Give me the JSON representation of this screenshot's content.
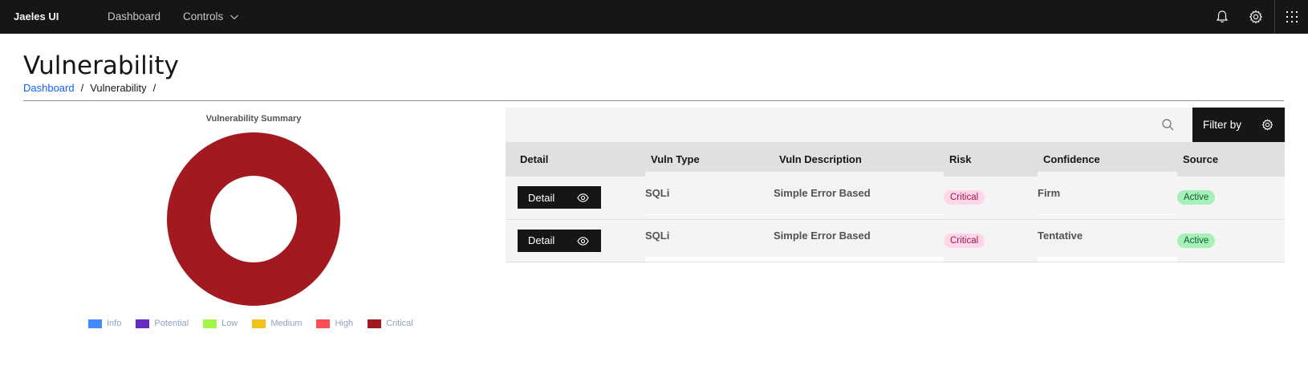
{
  "header": {
    "brand": "Jaeles UI",
    "nav": {
      "dashboard": "Dashboard",
      "controls": "Controls"
    },
    "icons": [
      "bell-icon",
      "gear-icon",
      "app-grid-icon"
    ]
  },
  "page": {
    "title": "Vulnerability",
    "breadcrumb": {
      "link": "Dashboard",
      "current": "Vulnerability",
      "separator": "/"
    }
  },
  "chart_data": {
    "type": "pie",
    "title": "Vulnerability Summary",
    "donut": true,
    "categories": [
      "Info",
      "Potential",
      "Low",
      "Medium",
      "High",
      "Critical"
    ],
    "values": [
      0,
      0,
      0,
      0,
      0,
      2
    ],
    "colors": [
      "#4589ff",
      "#6929c4",
      "#a2f64a",
      "#f1c21b",
      "#fa4d56",
      "#a2191f"
    ],
    "legend_position": "bottom"
  },
  "table": {
    "filter_label": "Filter by",
    "headers": [
      "Detail",
      "Vuln Type",
      "Vuln Description",
      "Risk",
      "Confidence",
      "Source"
    ],
    "rows": [
      {
        "detail": "Detail",
        "vuln_type": "SQLi",
        "description": "Simple Error Based",
        "risk": "Critical",
        "confidence": "Firm",
        "source": "Active"
      },
      {
        "detail": "Detail",
        "vuln_type": "SQLi",
        "description": "Simple Error Based",
        "risk": "Critical",
        "confidence": "Tentative",
        "source": "Active"
      }
    ]
  }
}
